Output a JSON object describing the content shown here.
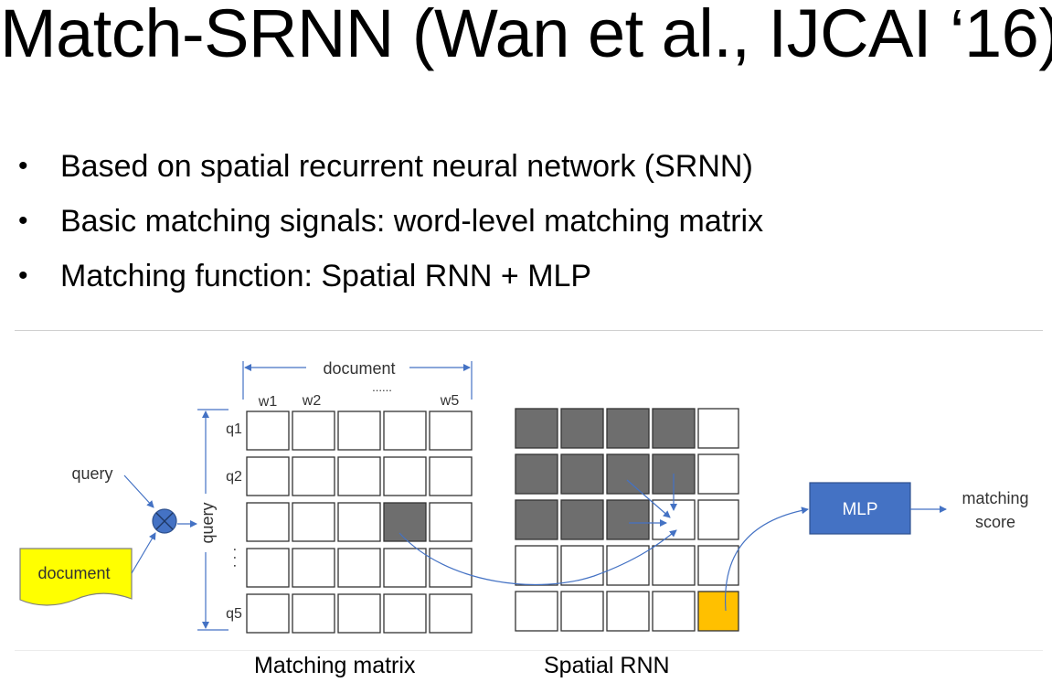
{
  "slide": {
    "title": "Match-SRNN (Wan et al., IJCAI ‘16)",
    "bullets": [
      "Based on spatial recurrent neural network (SRNN)",
      "Basic matching signals: word-level matching matrix",
      "Matching function: Spatial RNN + MLP"
    ]
  },
  "diagram": {
    "query_label": "query",
    "document_box_label": "document",
    "top_axis_label": "document",
    "top_dots": "......",
    "column_labels": [
      "w1",
      "w2",
      "w5"
    ],
    "row_labels": [
      "q1",
      "q2",
      "q5"
    ],
    "side_axis_label": "query",
    "side_dots": ". . .",
    "mlp_label": "MLP",
    "output_label_line1": "matching",
    "output_label_line2": "score",
    "matching_matrix_caption": "Matching matrix",
    "spatial_rnn_caption": "Spatial RNN",
    "colors": {
      "arrow": "#4472C4",
      "mlp_fill": "#4472C4",
      "document_fill": "#FFFF00",
      "highlight": "#FFC000",
      "cell_gray": "#6e6e6e"
    }
  }
}
